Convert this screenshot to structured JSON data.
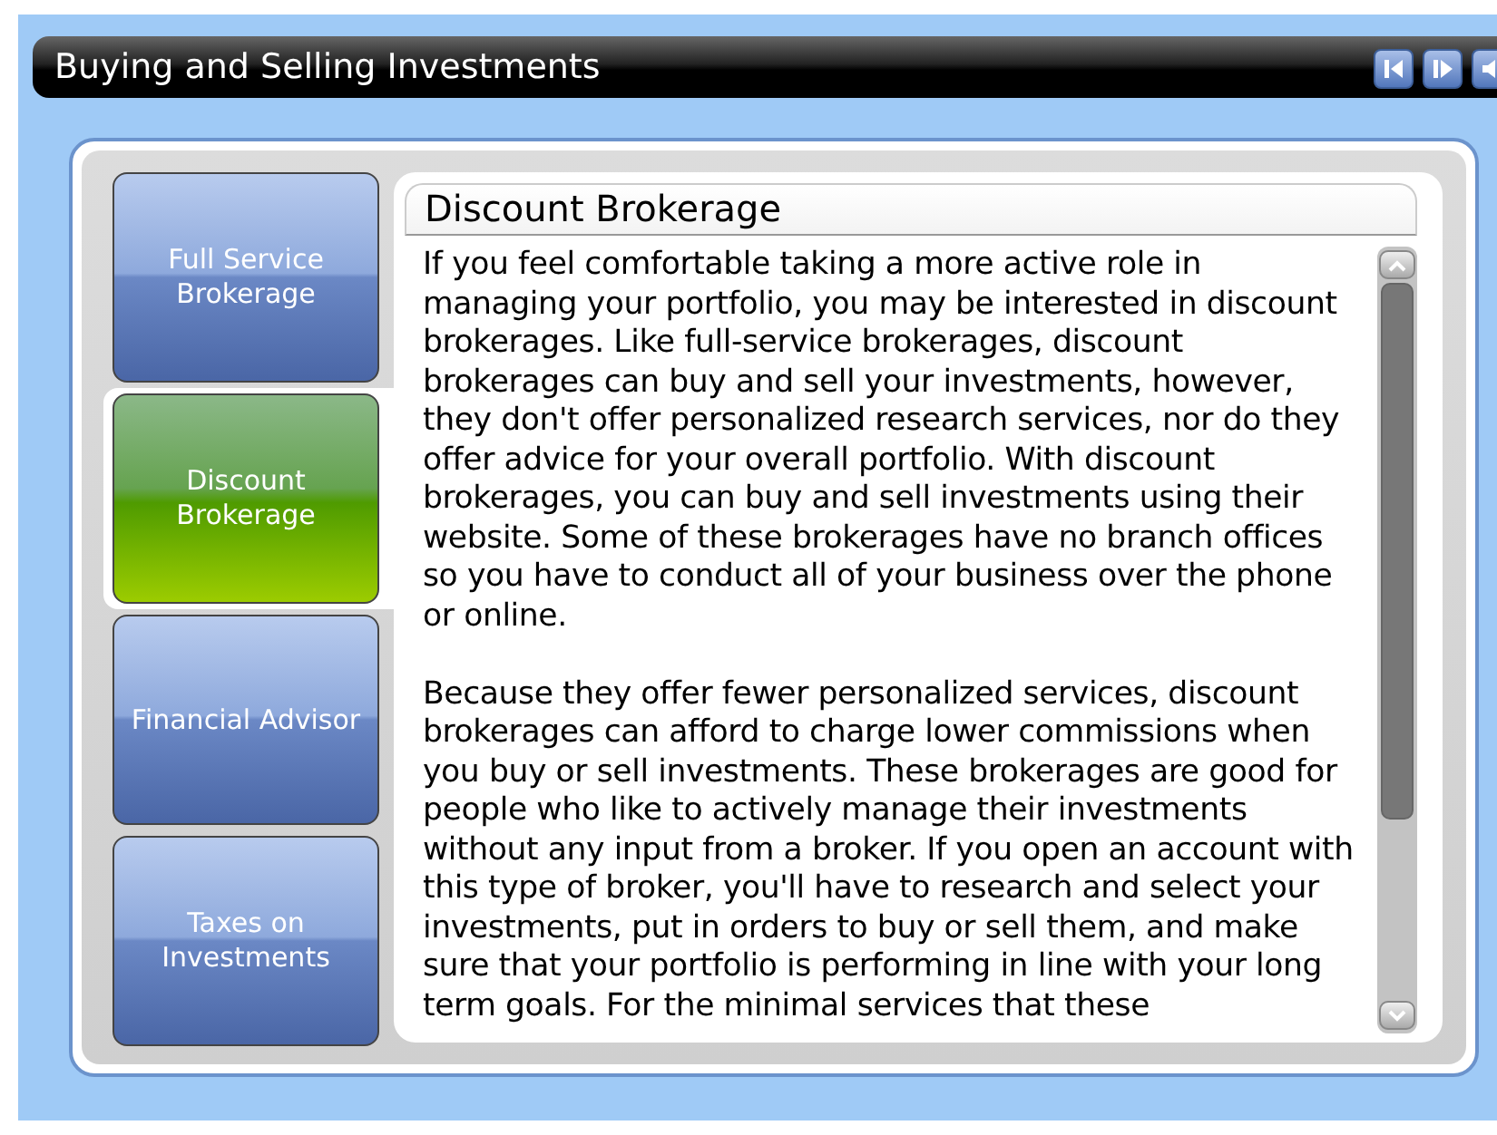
{
  "window": {
    "title": "Buying and Selling Investments"
  },
  "tabs": [
    {
      "label": "Full Service Brokerage",
      "selected": false
    },
    {
      "label": "Discount Brokerage",
      "selected": true
    },
    {
      "label": "Financial Advisor",
      "selected": false
    },
    {
      "label": "Taxes on Investments",
      "selected": false
    }
  ],
  "content": {
    "heading": "Discount Brokerage",
    "paragraphs": [
      "If you feel comfortable taking a more active role in managing your portfolio, you may be interested in discount brokerages. Like full-service brokerages, discount brokerages can buy and sell your investments, however, they don't offer personalized research services, nor do they offer advice for your overall portfolio. With discount brokerages, you can buy and sell investments using their website. Some of these brokerages have no branch offices so you have to conduct all of your business over the phone or online.",
      "Because they offer fewer personalized services, discount brokerages can afford to charge lower commissions when you buy or sell investments. These brokerages are good for people who like to actively manage their investments without any input from a broker. If you open an account with this type of broker, you'll have to research and select your investments, put in orders to buy or sell them, and make sure that your portfolio is performing in line with your long term goals. For the minimal services that these"
    ]
  }
}
